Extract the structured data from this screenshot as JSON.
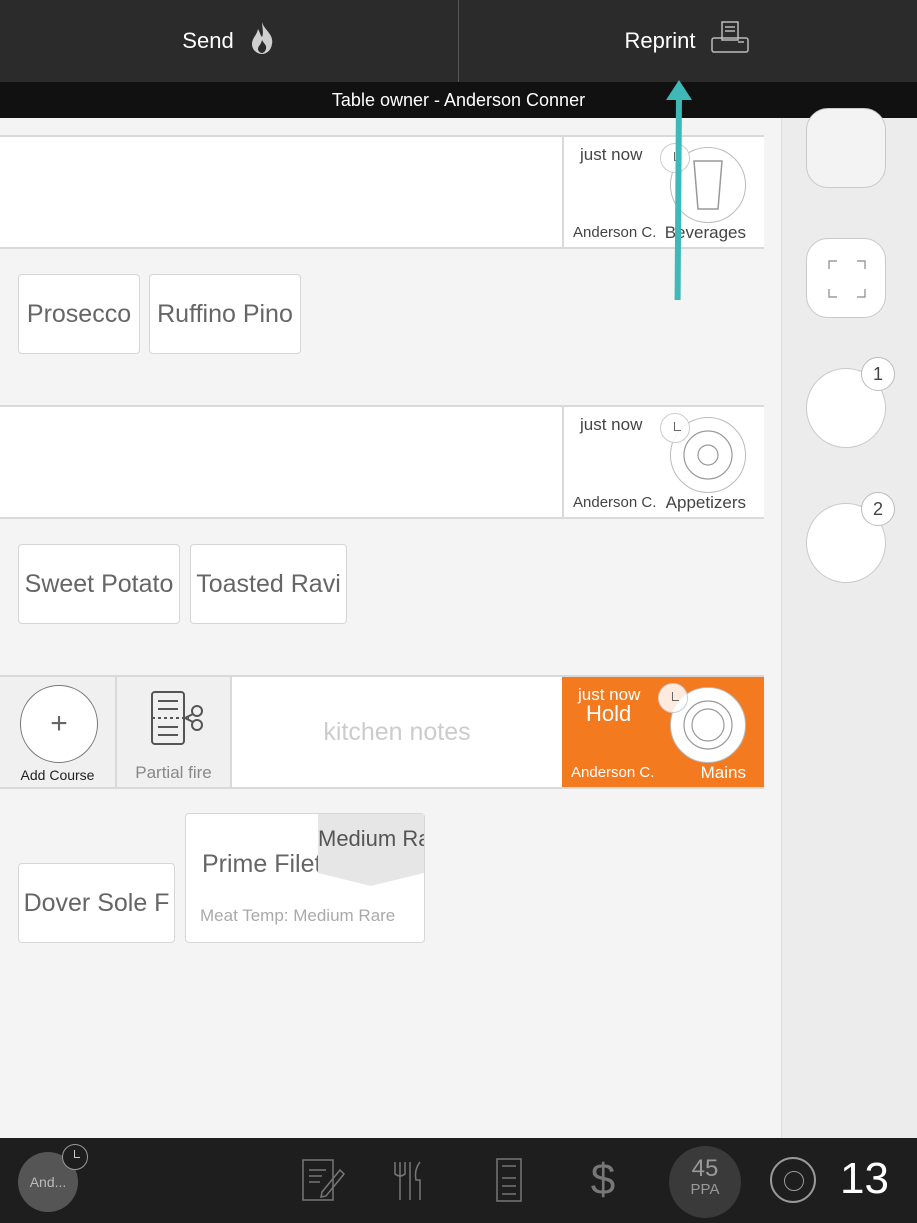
{
  "topbar": {
    "send_label": "Send",
    "send_icon": "flame-icon",
    "reprint_label": "Reprint",
    "reprint_icon": "printer-icon"
  },
  "owner_bar": {
    "text": "Table owner - Anderson Conner"
  },
  "courses": [
    {
      "when": "just now",
      "server": "Anderson C.",
      "name": "Beverages",
      "icon": "glass-icon",
      "status": ""
    },
    {
      "when": "just now",
      "server": "Anderson C.",
      "name": "Appetizers",
      "icon": "plate-icon",
      "status": ""
    },
    {
      "when": "just now",
      "server": "Anderson C.",
      "name": "Mains",
      "icon": "plate-icon",
      "status": "Hold"
    }
  ],
  "items": {
    "beverages": [
      "Prosecco",
      "Ruffino Pino"
    ],
    "appetizers": [
      "Sweet Potato",
      "Toasted Ravi"
    ],
    "mains": [
      {
        "name": "Dover Sole F"
      },
      {
        "name": "Prime Filet",
        "tag": "Medium Rare",
        "modifier": "Meat Temp: Medium Rare"
      }
    ]
  },
  "mains_tools": {
    "add_course_label": "Add Course",
    "partial_fire_label": "Partial fire",
    "kitchen_notes_placeholder": "kitchen notes"
  },
  "rail": {
    "seats": [
      "1",
      "2"
    ]
  },
  "bottombar": {
    "avatar_text": "And...",
    "ppa_value": "45",
    "ppa_label": "PPA",
    "guest_count": "13"
  },
  "colors": {
    "hold": "#f47a20",
    "annotation_arrow": "#3fb8b8",
    "topbar": "#2b2b2b"
  }
}
